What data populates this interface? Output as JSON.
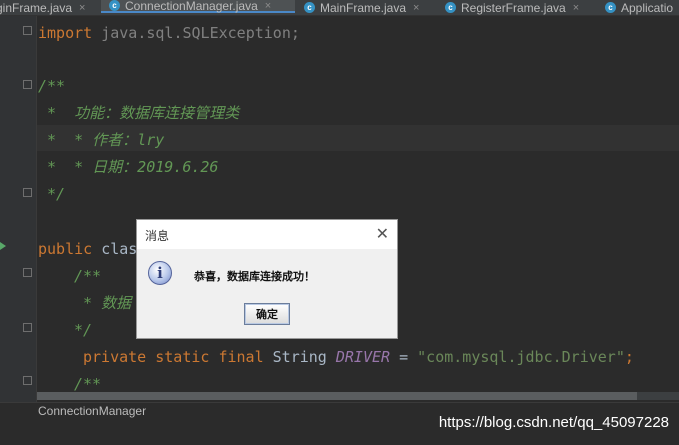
{
  "tabs": [
    {
      "label": "ginFrame.java",
      "icon": "class-icon",
      "active": false
    },
    {
      "label": "ConnectionManager.java",
      "icon": "class-icon",
      "active": true
    },
    {
      "label": "MainFrame.java",
      "icon": "class-icon",
      "active": false
    },
    {
      "label": "RegisterFrame.java",
      "icon": "class-icon",
      "active": false
    },
    {
      "label": "Applicatio",
      "icon": "class-icon",
      "active": false
    }
  ],
  "tab_close_glyph": "×",
  "tab_icon_glyph": "c",
  "code": {
    "l1_kw": "import",
    "l1_rest": " java.sql.SQLException;",
    "l2": "/**",
    "l3": " *  功能：数据库连接管理类",
    "l4": " *  * 作者：lry",
    "l5": " *  * 日期：2019.6.26",
    "l6": " */",
    "l7_kw": "public",
    "l7_rest": " clas",
    "l8": "/**",
    "l9": " * 数据",
    "l10": "*/",
    "l11_kw": "private static final",
    "l11_type": " String ",
    "l11_const": "DRIVER",
    "l11_eq": " = ",
    "l11_str": "\"com.mysql.jdbc.Driver\"",
    "l11_end": ";",
    "l12": "/**"
  },
  "breadcrumb": "ConnectionManager",
  "watermark": "https://blog.csdn.net/qq_45097228",
  "dialog": {
    "title": "消息",
    "close_glyph": "✕",
    "icon_glyph": "i",
    "message": "恭喜，数据库连接成功！",
    "ok_label": "确定"
  },
  "colors": {
    "editor_bg": "#2b2b2b",
    "keyword": "#cc7832",
    "comment": "#629755",
    "string": "#6a8759",
    "constant": "#9876aa",
    "accent": "#4a88c7"
  }
}
